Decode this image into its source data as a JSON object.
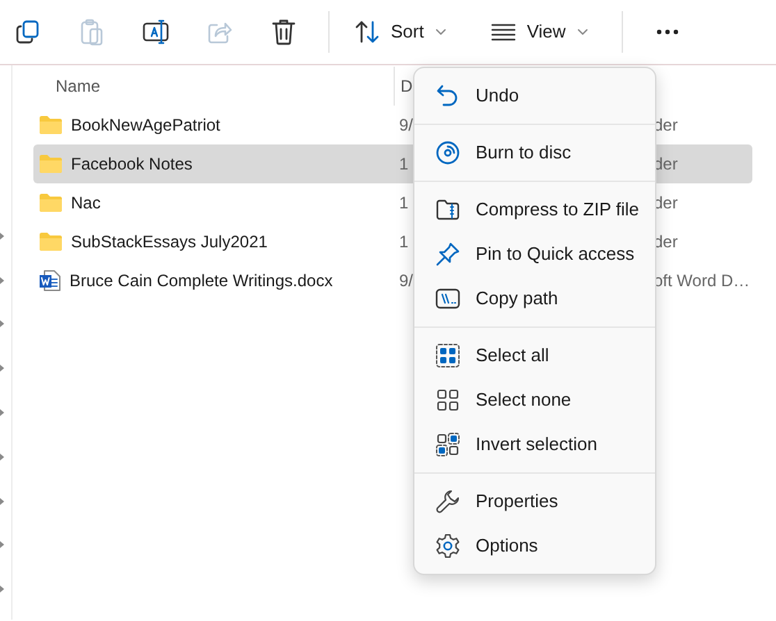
{
  "toolbar": {
    "buttons": [
      {
        "kind": "copy",
        "disabled": false
      },
      {
        "kind": "paste",
        "disabled": true
      },
      {
        "kind": "rename",
        "disabled": false
      },
      {
        "kind": "share",
        "disabled": true
      },
      {
        "kind": "delete",
        "disabled": false
      }
    ],
    "menus": [
      {
        "kind": "sort",
        "label": "Sort"
      },
      {
        "kind": "view",
        "label": "View"
      }
    ]
  },
  "file_list": {
    "columns": [
      {
        "label": "Name"
      },
      {
        "label": "D"
      }
    ],
    "rows": [
      {
        "kind": "folder",
        "name": "BookNewAgePatriot",
        "column_2": "9/",
        "column_3": "der",
        "selected": false
      },
      {
        "kind": "folder",
        "name": "Facebook Notes",
        "column_2": "1",
        "column_3": "der",
        "selected": true
      },
      {
        "kind": "folder",
        "name": "Nac",
        "column_2": "1",
        "column_3": "der",
        "selected": false
      },
      {
        "kind": "folder",
        "name": "SubStackEssays July2021",
        "column_2": "1",
        "column_3": "der",
        "selected": false
      },
      {
        "kind": "word",
        "name": "Bruce Cain Complete Writings.docx",
        "column_2": "9/",
        "column_3": "oft Word D…",
        "selected": false
      }
    ]
  },
  "context_menu": {
    "groups": [
      [
        {
          "kind": "undo",
          "label": "Undo"
        }
      ],
      [
        {
          "kind": "burn",
          "label": "Burn to disc"
        }
      ],
      [
        {
          "kind": "zip",
          "label": "Compress to ZIP file"
        },
        {
          "kind": "pin",
          "label": "Pin to Quick access"
        },
        {
          "kind": "path",
          "label": "Copy path"
        }
      ],
      [
        {
          "kind": "select_all",
          "label": "Select all"
        },
        {
          "kind": "select_none",
          "label": "Select none"
        },
        {
          "kind": "invert",
          "label": "Invert selection"
        }
      ],
      [
        {
          "kind": "properties",
          "label": "Properties"
        },
        {
          "kind": "options",
          "label": "Options"
        }
      ]
    ]
  }
}
